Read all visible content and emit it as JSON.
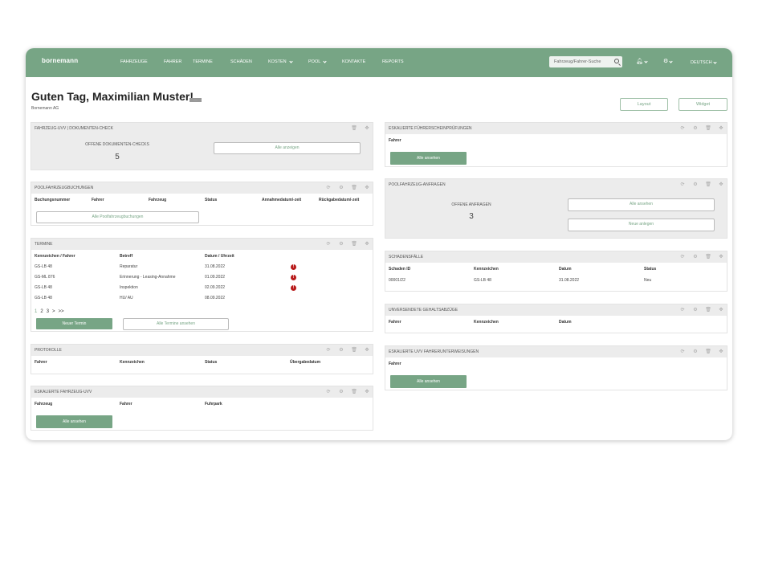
{
  "header": {
    "logo": "bornemann",
    "nav": [
      "FAHRZEUGE",
      "FAHRER",
      "TERMINE",
      "SCHÄDEN",
      "KOSTEN",
      "POOL",
      "KONTAKTE",
      "REPORTS"
    ],
    "search_placeholder": "Fahrzeug/Fahrer-Suche",
    "language": "DEUTSCH"
  },
  "page": {
    "greeting": "Guten Tag, Maximilian Muster!",
    "company": "Bornemann AG",
    "layout_btn": "Layout",
    "widget_btn": "Widget"
  },
  "widgets": {
    "doc_check": {
      "title": "FAHRZEUG-UVV | DOKUMENTEN-CHECK",
      "label": "OFFENE DOKUMENTEN-CHECKS",
      "count": "5",
      "btn": "Alle anzeigen"
    },
    "pool_booking": {
      "title": "POOLFAHRZEUGBUCHUNGEN",
      "cols": [
        "Buchungsnummer",
        "Fahrer",
        "Fahrzeug",
        "Status",
        "Annahmedatum/-zeit",
        "Rückgabedatum/-zeit"
      ],
      "btn": "Alle Poolfahrzeugbuchungen"
    },
    "termine": {
      "title": "TERMINE",
      "cols": [
        "Kennzeichen / Fahrer",
        "Betreff",
        "Datum / Uhrzeit"
      ],
      "rows": [
        [
          "GS-LB 48",
          "Reparatur",
          "31.08.2022",
          "!"
        ],
        [
          "GS-ML 876",
          "Erinnerung - Leasing-Annahme",
          "01.09.2022",
          "!"
        ],
        [
          "GS-LB 48",
          "Inspektion",
          "02.09.2022",
          "!"
        ],
        [
          "GS-LB 48",
          "HU/ AU",
          "08.09.2022",
          ""
        ]
      ],
      "pages": [
        "1",
        "2",
        "3",
        ">",
        ">>"
      ],
      "btn_new": "Neuer Termin",
      "btn_all": "Alle Termine ansehen"
    },
    "protokolle": {
      "title": "PROTOKOLLE",
      "cols": [
        "Fahrer",
        "Kennzeichen",
        "Status",
        "Übergabedatum"
      ]
    },
    "esc_uvv": {
      "title": "ESKALIERTE FAHRZEUG-UVV",
      "cols": [
        "Fahrzeug",
        "Fahrer",
        "Fuhrpark"
      ],
      "btn": "Alle ansehen"
    },
    "esc_license": {
      "title": "ESKALIERTE FÜHRERSCHEINPRÜFUNGEN",
      "col": "Fahrer",
      "btn": "Alle ansehen"
    },
    "pool_req": {
      "title": "POOLFAHRZEUG-ANFRAGEN",
      "label": "OFFENE ANFRAGEN",
      "count": "3",
      "btn_all": "Alle ansehen",
      "btn_new": "Neue anlegen"
    },
    "damages": {
      "title": "SCHADENSFÄLLE",
      "cols": [
        "Schaden ID",
        "Kennzeichen",
        "Datum",
        "Status"
      ],
      "rows": [
        [
          "00001/22",
          "GS-LB 48",
          "31.08.2022",
          "Neu"
        ]
      ]
    },
    "salary": {
      "title": "UNVERSENDETE GEHALTSABZÜGE",
      "cols": [
        "Fahrer",
        "Kennzeichen",
        "Datum"
      ]
    },
    "instruct": {
      "title": "ESKALIERTE UVV FAHRERUNTERWEISUNGEN",
      "col": "Fahrer",
      "btn": "Alle ansehen"
    }
  },
  "colors": {
    "brand": "#77a585",
    "alert": "#b81a1a"
  }
}
